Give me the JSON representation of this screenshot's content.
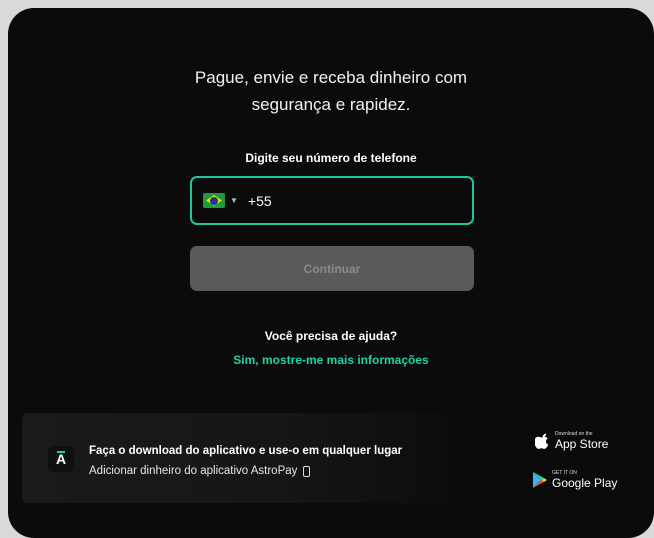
{
  "headline": {
    "line1": "Pague, envie e receba dinheiro com",
    "line2": "segurança e rapidez."
  },
  "phone": {
    "label": "Digite seu número de telefone",
    "country": "BR",
    "value": "+55"
  },
  "continue_label": "Continuar",
  "help": {
    "question": "Você precisa de ajuda?",
    "link": "Sim, mostre-me mais informações"
  },
  "banner": {
    "logo_letter": "A",
    "title": "Faça o download do aplicativo e use-o em qualquer lugar",
    "subtitle": "Adicionar dinheiro do aplicativo AstroPay"
  },
  "stores": {
    "apple_small": "Download on the",
    "apple_big": "App Store",
    "google_small": "GET IT ON",
    "google_big": "Google Play"
  },
  "colors": {
    "background": "#0b0b0b",
    "accent": "#1fd1a4",
    "button_disabled": "#5a5a5a"
  }
}
